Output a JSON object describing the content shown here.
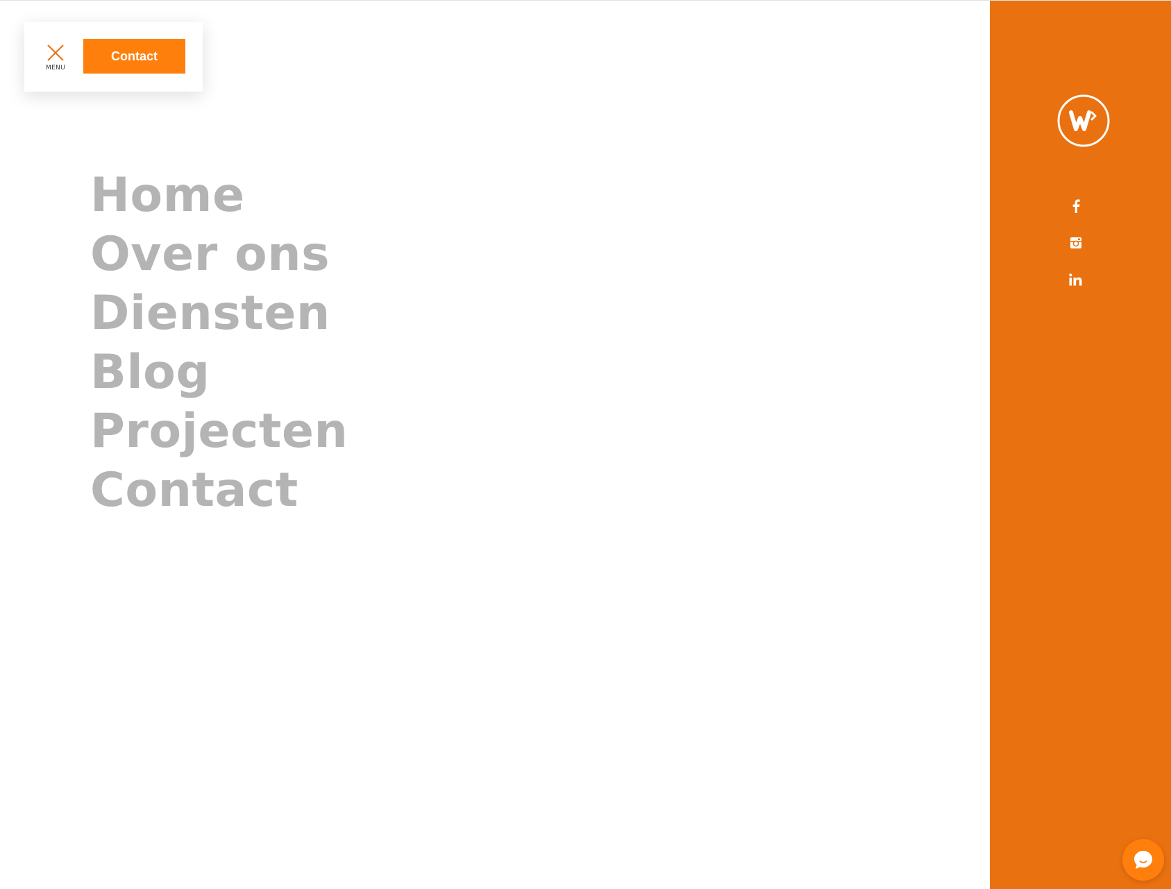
{
  "header": {
    "menu_label": "MENU",
    "close_icon": "close-x-icon",
    "contact_button_label": "Contact"
  },
  "nav": {
    "items": [
      {
        "label": "Home"
      },
      {
        "label": "Over ons"
      },
      {
        "label": "Diensten"
      },
      {
        "label": "Blog"
      },
      {
        "label": "Projecten"
      },
      {
        "label": "Contact"
      }
    ]
  },
  "side_panel": {
    "logo_icon": "brand-w-logo-icon",
    "social": [
      {
        "name": "facebook",
        "icon": "facebook-icon"
      },
      {
        "name": "instagram",
        "icon": "instagram-icon"
      },
      {
        "name": "linkedin",
        "icon": "linkedin-icon"
      }
    ]
  },
  "chat": {
    "icon": "chat-bubble-icon"
  },
  "colors": {
    "accent_orange": "#ff7f0d",
    "panel_orange": "#ea7110",
    "nav_text_grey": "#b4b4b4",
    "background": "#ffffff"
  }
}
